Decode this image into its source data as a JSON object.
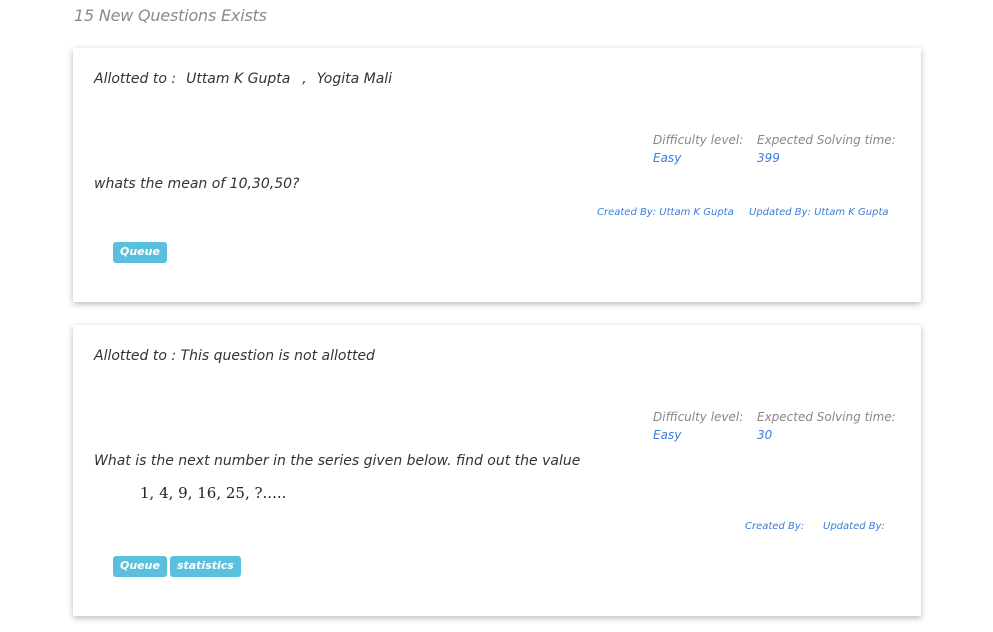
{
  "header": {
    "title": "15 New Questions Exists"
  },
  "questions": [
    {
      "allotted_label": "Allotted to :",
      "allotted_names": [
        "Uttam K Gupta",
        "Yogita Mali"
      ],
      "allotted_separator": ",",
      "difficulty_label": "Difficulty level:",
      "difficulty_value": "Easy",
      "time_label": "Expected Solving time:",
      "time_value": "399",
      "question_text": "whats the mean of 10,30,50?",
      "created_by": "Created By: Uttam K Gupta",
      "updated_by": "Updated By: Uttam K Gupta",
      "tags": [
        "Queue"
      ]
    },
    {
      "allotted_label": "Allotted to :",
      "allotted_text": "This question is not allotted",
      "difficulty_label": "Difficulty level:",
      "difficulty_value": "Easy",
      "time_label": "Expected Solving time:",
      "time_value": "30",
      "question_text": "What is the next number in the series given below. find out the value",
      "series_text": "1, 4, 9, 16, 25, ?.....",
      "created_by": "Created By:",
      "updated_by": "Updated By:",
      "tags": [
        "Queue",
        "statistics"
      ]
    }
  ],
  "colors": {
    "tag_background": "#5bc0de",
    "link_blue": "#3b7dd8",
    "muted_text": "#888888"
  }
}
